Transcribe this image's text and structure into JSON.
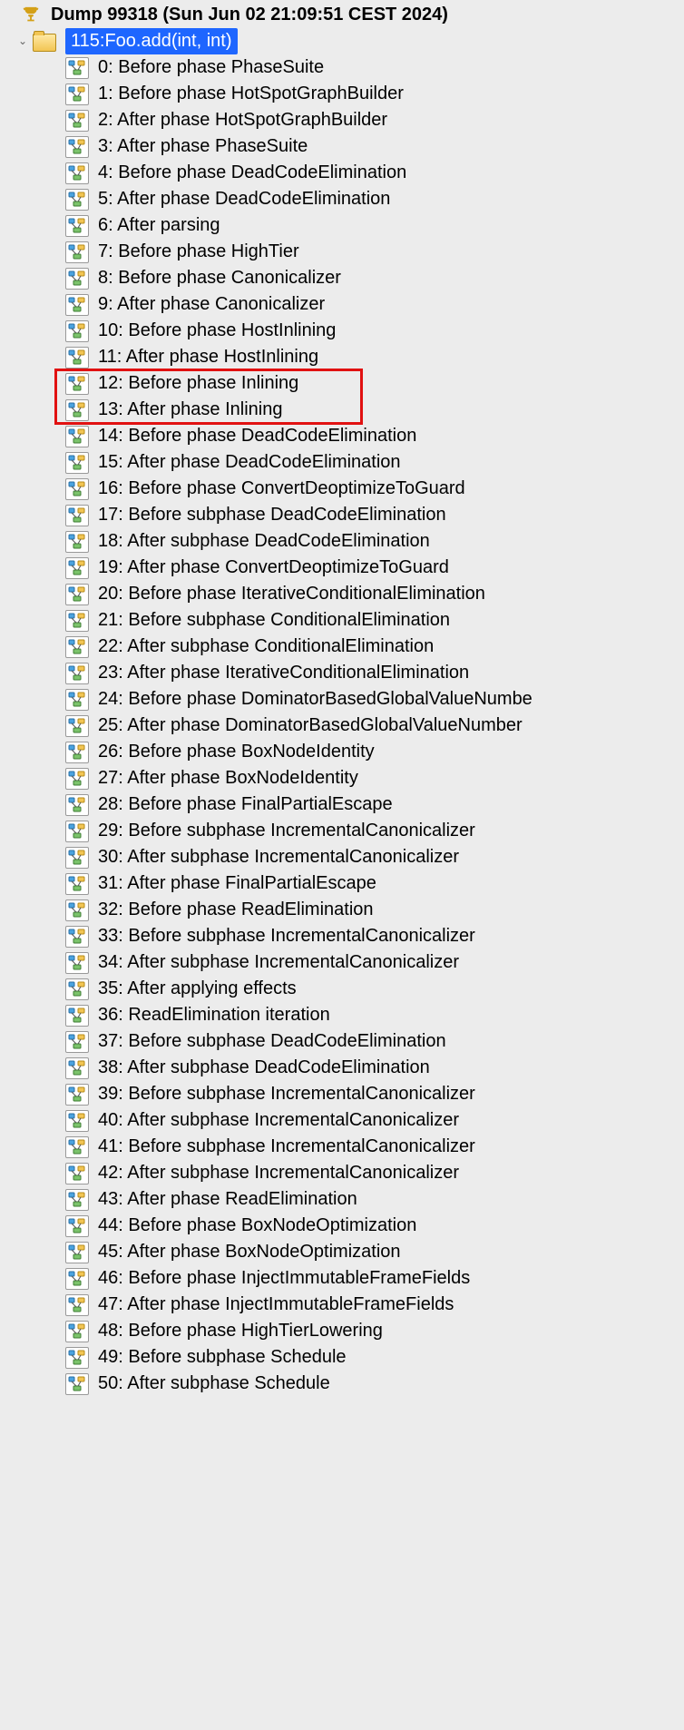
{
  "root": {
    "label": "Dump 99318 (Sun Jun 02 21:09:51 CEST 2024)"
  },
  "folder": {
    "label": "115:Foo.add(int, int)"
  },
  "items": [
    {
      "label": "0: Before phase PhaseSuite"
    },
    {
      "label": "1: Before phase HotSpotGraphBuilder"
    },
    {
      "label": "2: After phase HotSpotGraphBuilder"
    },
    {
      "label": "3: After phase PhaseSuite"
    },
    {
      "label": "4: Before phase DeadCodeElimination"
    },
    {
      "label": "5: After phase DeadCodeElimination"
    },
    {
      "label": "6: After parsing"
    },
    {
      "label": "7: Before phase HighTier"
    },
    {
      "label": "8: Before phase Canonicalizer"
    },
    {
      "label": "9: After phase Canonicalizer"
    },
    {
      "label": "10: Before phase HostInlining"
    },
    {
      "label": "11: After phase HostInlining"
    },
    {
      "label": "12: Before phase Inlining"
    },
    {
      "label": "13: After phase Inlining"
    },
    {
      "label": "14: Before phase DeadCodeElimination"
    },
    {
      "label": "15: After phase DeadCodeElimination"
    },
    {
      "label": "16: Before phase ConvertDeoptimizeToGuard"
    },
    {
      "label": "17: Before subphase DeadCodeElimination"
    },
    {
      "label": "18: After subphase DeadCodeElimination"
    },
    {
      "label": "19: After phase ConvertDeoptimizeToGuard"
    },
    {
      "label": "20: Before phase IterativeConditionalElimination"
    },
    {
      "label": "21: Before subphase ConditionalElimination"
    },
    {
      "label": "22: After subphase ConditionalElimination"
    },
    {
      "label": "23: After phase IterativeConditionalElimination"
    },
    {
      "label": "24: Before phase DominatorBasedGlobalValueNumbe"
    },
    {
      "label": "25: After phase DominatorBasedGlobalValueNumber"
    },
    {
      "label": "26: Before phase BoxNodeIdentity"
    },
    {
      "label": "27: After phase BoxNodeIdentity"
    },
    {
      "label": "28: Before phase FinalPartialEscape"
    },
    {
      "label": "29: Before subphase IncrementalCanonicalizer"
    },
    {
      "label": "30: After subphase IncrementalCanonicalizer"
    },
    {
      "label": "31: After phase FinalPartialEscape"
    },
    {
      "label": "32: Before phase ReadElimination"
    },
    {
      "label": "33: Before subphase IncrementalCanonicalizer"
    },
    {
      "label": "34: After subphase IncrementalCanonicalizer"
    },
    {
      "label": "35: After applying effects"
    },
    {
      "label": "36: ReadElimination iteration"
    },
    {
      "label": "37: Before subphase DeadCodeElimination"
    },
    {
      "label": "38: After subphase DeadCodeElimination"
    },
    {
      "label": "39: Before subphase IncrementalCanonicalizer"
    },
    {
      "label": "40: After subphase IncrementalCanonicalizer"
    },
    {
      "label": "41: Before subphase IncrementalCanonicalizer"
    },
    {
      "label": "42: After subphase IncrementalCanonicalizer"
    },
    {
      "label": "43: After phase ReadElimination"
    },
    {
      "label": "44: Before phase BoxNodeOptimization"
    },
    {
      "label": "45: After phase BoxNodeOptimization"
    },
    {
      "label": "46: Before phase InjectImmutableFrameFields"
    },
    {
      "label": "47: After phase InjectImmutableFrameFields"
    },
    {
      "label": "48: Before phase HighTierLowering"
    },
    {
      "label": "49: Before subphase Schedule"
    },
    {
      "label": "50: After subphase Schedule"
    }
  ],
  "highlight": {
    "start_index": 12,
    "end_index": 13
  }
}
